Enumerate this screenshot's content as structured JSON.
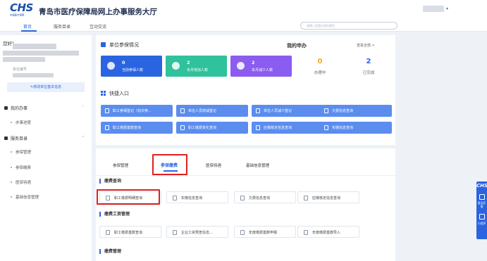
{
  "header": {
    "logo_mark": "CHS",
    "logo_sub": "中国医疗保障",
    "title": "青岛市医疗保障局网上办事服务大厅",
    "user_caret": "▾"
  },
  "nav": {
    "items": [
      "首页",
      "服务目录",
      "互动交流"
    ],
    "active_index": 0
  },
  "search": {
    "placeholder": "请输入您要办理的事项"
  },
  "left_panel": {
    "greeting": "您好！",
    "unit_id_label": "单位编号",
    "modify_button": "✎修改单位基本信息",
    "menu": {
      "my_affairs": "我的办事",
      "my_affairs_items": [
        "办事进度"
      ],
      "service_catalog": "服务目录",
      "service_items": [
        "参保管理",
        "参保缴费",
        "医保待遇",
        "基础信息管理"
      ],
      "caret_up": "^",
      "caret_down": "˅"
    }
  },
  "enrollment": {
    "title": "单位参保情况",
    "stats": [
      {
        "value": "0",
        "label": "当前参保人数",
        "color": "#2b64e0"
      },
      {
        "value": "2",
        "label": "本月增加人数",
        "color": "#2fc29c"
      },
      {
        "value": "2",
        "label": "本月减少人数",
        "color": "#8a5cf0"
      }
    ]
  },
  "applications": {
    "title": "我的申办",
    "view_all": "查看全部 >",
    "in_progress": {
      "value": "0",
      "label": "办理中"
    },
    "completed": {
      "value": "2",
      "label": "已完成"
    }
  },
  "quick_entry": {
    "title": "快捷入口",
    "buttons": [
      "职工参保登记（初次参...",
      "单位人员增减登记",
      "单位人员减少登记",
      "欠费信息查询",
      "职工缴费基数查询",
      "职工缴费变化查询",
      "应缴核定信息查询",
      "实缴信息查询"
    ]
  },
  "services": {
    "tabs": [
      "参保管理",
      "参保缴费",
      "医保待遇",
      "基础信息管理"
    ],
    "active_tab": 1,
    "groups": [
      {
        "title": "缴费查询",
        "items": [
          "职工缴费明细查询",
          "实缴信息查询",
          "欠费信息查询",
          "应缴核定信息查询"
        ]
      },
      {
        "title": "缴费工资管理",
        "items": [
          "职工缴费基数查询",
          "企业工资预查信息...",
          "年度缴费基数申报",
          "年度缴费基数导入"
        ]
      },
      {
        "title": "缴费管理",
        "items": []
      }
    ]
  },
  "float_bar": {
    "logo": "CHS",
    "items": [
      "意见反馈",
      "小程序"
    ]
  },
  "colors": {
    "accent": "#2b64e0",
    "quick_button": "#5b8def",
    "highlight_box": "#e02020",
    "in_progress": "#f5a623"
  }
}
